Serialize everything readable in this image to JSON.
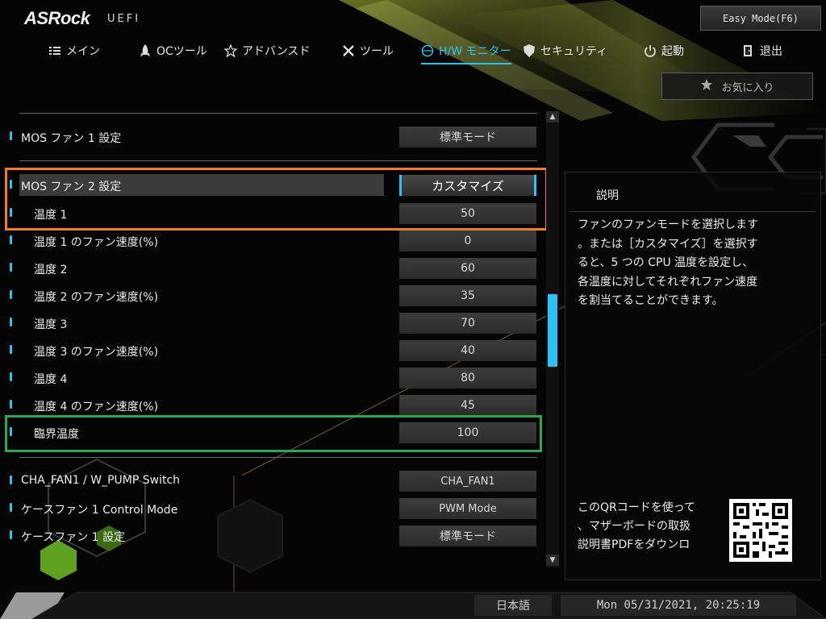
{
  "brand": {
    "logo": "ASRock",
    "product": "UEFI"
  },
  "header": {
    "easy_mode_label": "Easy Mode(F6)",
    "favorites_label": "お気に入り"
  },
  "nav": {
    "items": [
      {
        "label": "メイン",
        "icon": "list-icon"
      },
      {
        "label": "OCツール",
        "icon": "rocket-icon"
      },
      {
        "label": "アドバンスド",
        "icon": "star-outline-icon"
      },
      {
        "label": "ツール",
        "icon": "tools-icon"
      },
      {
        "label": "H/W モニター",
        "icon": "monitor-icon",
        "active": true
      },
      {
        "label": "セキュリティ",
        "icon": "shield-icon"
      },
      {
        "label": "起動",
        "icon": "power-icon"
      },
      {
        "label": "退出",
        "icon": "exit-door-icon"
      }
    ]
  },
  "settings": [
    {
      "label": "MOS ファン 1 設定",
      "value": "標準モード"
    },
    {
      "label": "MOS ファン 2 設定",
      "value": "カスタマイズ",
      "selected": true
    },
    {
      "label": "温度 1",
      "value": "50"
    },
    {
      "label": "温度 1 のファン速度(%)",
      "value": "0"
    },
    {
      "label": "温度 2",
      "value": "60"
    },
    {
      "label": "温度 2 のファン速度(%)",
      "value": "35"
    },
    {
      "label": "温度 3",
      "value": "70"
    },
    {
      "label": "温度 3 のファン速度(%)",
      "value": "40"
    },
    {
      "label": "温度 4",
      "value": "80"
    },
    {
      "label": "温度 4 のファン速度(%)",
      "value": "45"
    },
    {
      "label": "臨界温度",
      "value": "100"
    },
    {
      "label": "CHA_FAN1 / W_PUMP Switch",
      "value": "CHA_FAN1"
    },
    {
      "label": "ケースファン 1 Control Mode",
      "value": "PWM Mode"
    },
    {
      "label": "ケースファン 1 設定",
      "value": "標準モード"
    }
  ],
  "description": {
    "title": "説明",
    "lines": [
      "ファンのファンモードを選択します",
      "。または［カスタマイズ］を選択す",
      "ると、5 つの CPU 温度を設定し、",
      "各温度に対してそれぞれファン速度",
      "を割当てることができます。"
    ],
    "qr_lines": [
      "このQRコードを使って",
      "、マザーボードの取扱",
      "説明書PDFをダウンロ"
    ]
  },
  "footer": {
    "language": "日本語",
    "datetime": "Mon 05/31/2021, 20:25:19"
  },
  "colors": {
    "accent": "#2bc2f2",
    "highlight_orange": "#f07c2a",
    "highlight_green": "#2aa84f"
  }
}
